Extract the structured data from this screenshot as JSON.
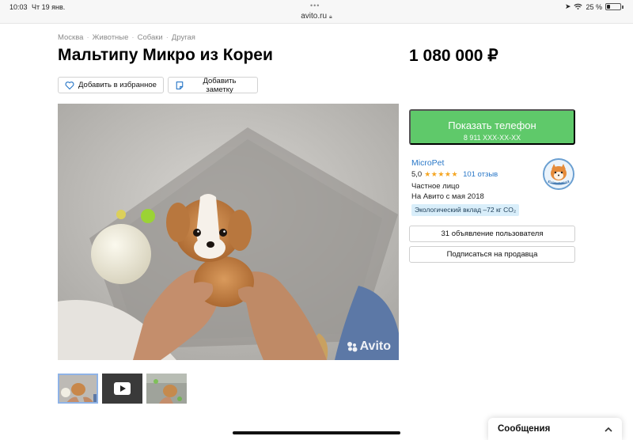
{
  "status_bar": {
    "time": "10:03",
    "date": "Чт 19 янв.",
    "url": "avito.ru",
    "battery": "25 %"
  },
  "breadcrumb": [
    "Москва",
    "Животные",
    "Собаки",
    "Другая"
  ],
  "listing": {
    "title": "Мальтипу Микро из Кореи",
    "price": "1 080 000 ₽"
  },
  "actions": {
    "favorite": "Добавить в избранное",
    "note": "Добавить заметку"
  },
  "gallery": {
    "watermark": "Avito",
    "thumbnails": [
      "photo",
      "video",
      "photo"
    ]
  },
  "phone": {
    "label": "Показать телефон",
    "number": "8 911 XXX-XX-XX"
  },
  "seller": {
    "name": "MicroPet",
    "rating": "5,0",
    "stars": "★★★★★",
    "reviews": "101 отзыв",
    "type": "Частное лицо",
    "since": "На Авито с мая 2018",
    "eco": "Экологический вклад –72 кг CO₂",
    "avatar_text": "MICROPET.KR"
  },
  "buttons": {
    "ads": "31 объявление пользователя",
    "subscribe": "Подписаться на продавца"
  },
  "messages": {
    "label": "Сообщения"
  },
  "colors": {
    "accent_green": "#5fc96a",
    "link_blue": "#2a78c8",
    "star_orange": "#f5a623"
  }
}
